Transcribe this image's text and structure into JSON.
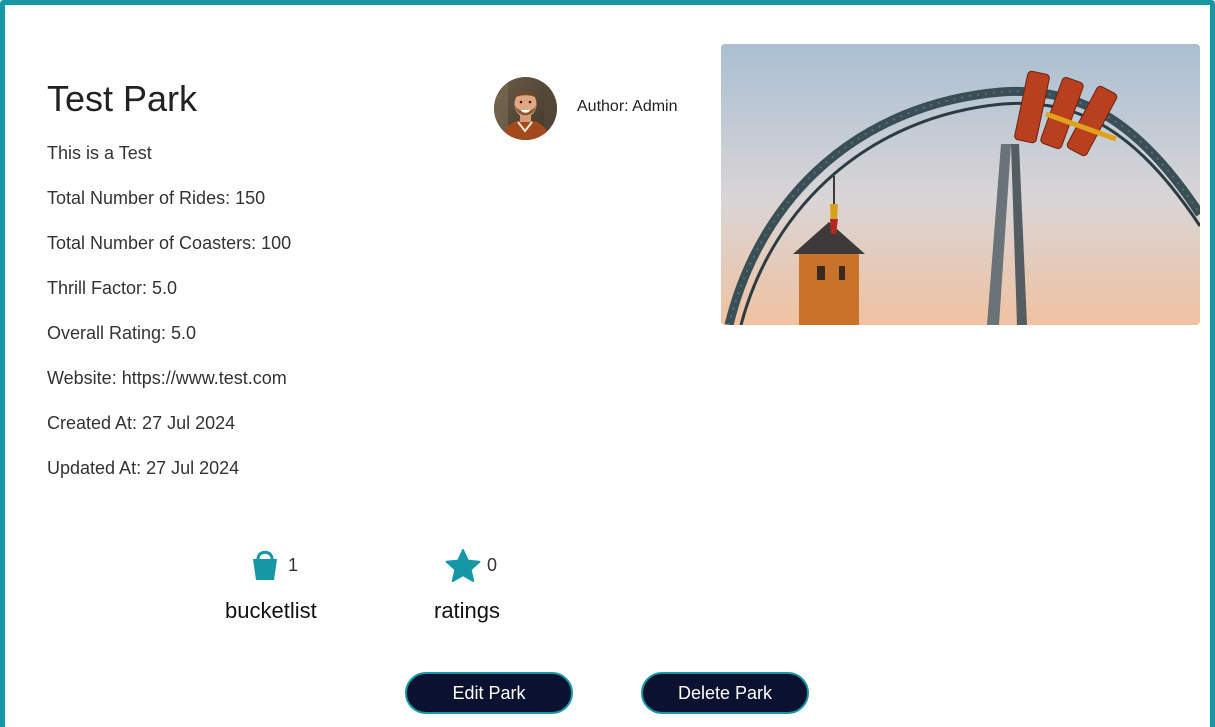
{
  "park": {
    "name": "Test Park",
    "description": "This is a Test",
    "total_rides": "Total Number of Rides: 150",
    "total_coasters": "Total Number of Coasters: 100",
    "thrill_factor": "Thrill Factor: 5.0",
    "overall_rating": "Overall Rating: 5.0",
    "website": "Website: https://www.test.com",
    "created_at": "Created At: 27 Jul 2024",
    "updated_at": "Updated At: 27 Jul 2024"
  },
  "author": {
    "label": "Author: Admin",
    "avatar_icon": "user-avatar"
  },
  "stats": {
    "bucketlist": {
      "count": "1",
      "label": "bucketlist",
      "icon": "bucket-icon"
    },
    "ratings": {
      "count": "0",
      "label": "ratings",
      "icon": "star-icon"
    }
  },
  "actions": {
    "edit_label": "Edit Park",
    "delete_label": "Delete Park"
  },
  "colors": {
    "accent": "#1597a6",
    "button_bg": "#0b1230",
    "text": "#333333"
  }
}
